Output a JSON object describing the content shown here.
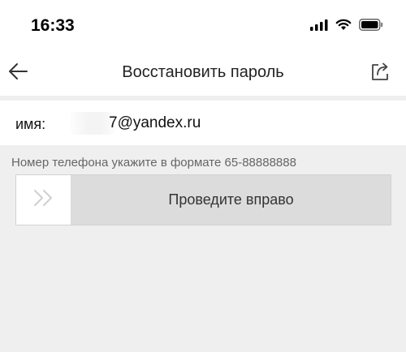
{
  "status_bar": {
    "time": "16:33",
    "icons": [
      "signal-icon",
      "wifi-icon",
      "battery-icon"
    ]
  },
  "nav": {
    "title": "Восстановить пароль",
    "back_icon": "arrow-left-icon",
    "share_icon": "share-icon"
  },
  "account": {
    "label": "имя:",
    "value": "7@yandex.ru"
  },
  "hint": "Номер телефона укажите в формате 65-88888888",
  "slider": {
    "label": "Проведите вправо",
    "handle_icon": "double-chevron-right-icon",
    "progress": 0
  }
}
